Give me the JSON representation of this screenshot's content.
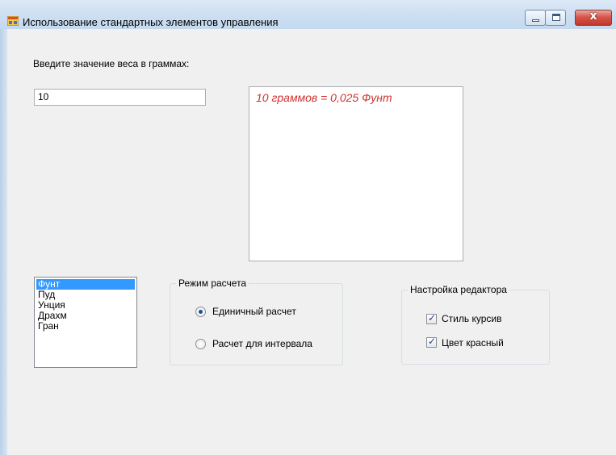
{
  "window": {
    "title": "Использование стандартных элементов управления",
    "buttons": {
      "minimize": "minimize",
      "maximize": "maximize",
      "close": "x"
    }
  },
  "form": {
    "weight_prompt": "Введите значение веса в граммах:",
    "weight_value": "10",
    "result_text": "10 граммов = 0,025 Фунт",
    "units": {
      "items": [
        "Фунт",
        "Пуд",
        "Унция",
        "Драхм",
        "Гран"
      ],
      "selected": "Фунт"
    },
    "calc_mode": {
      "title": "Режим расчета",
      "options": [
        {
          "label": "Единичный расчет",
          "checked": true
        },
        {
          "label": "Расчет для интервала",
          "checked": false
        }
      ]
    },
    "editor_settings": {
      "title": "Настройка редактора",
      "options": [
        {
          "label": "Стиль курсив",
          "checked": true
        },
        {
          "label": "Цвет красный",
          "checked": true
        }
      ]
    }
  },
  "colors": {
    "result_text": "#d03030",
    "selection": "#3399ff",
    "close_button": "#c2362a"
  }
}
